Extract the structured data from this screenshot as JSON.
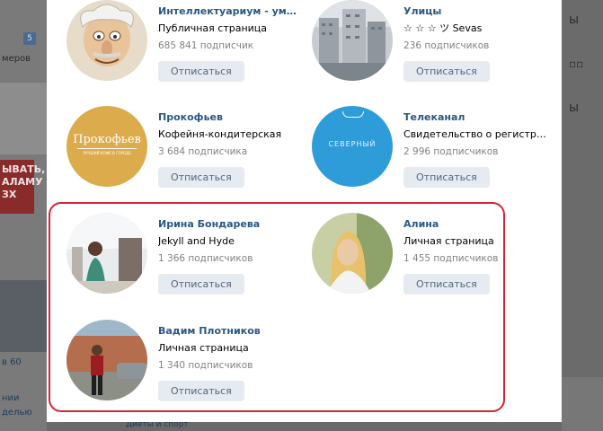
{
  "background": {
    "badge": "5",
    "text_lines": [
      "меров",
      "ЫВАТЬ,",
      "АЛАМУ",
      "ЗХ",
      "в 60",
      "нии",
      "делью",
      "Диеты и спорт"
    ],
    "right_text": [
      "ы",
      "ы"
    ]
  },
  "cards": [
    {
      "name": "Интеллектуариум - умный ...",
      "desc": "Публичная страница",
      "count": "685 841 подписчик",
      "button": "Отписаться",
      "avatar": "caricature-avatar"
    },
    {
      "name": "Улицы",
      "desc": "☆ ☆ ☆ ツ Sevas",
      "count": "236 подписчиков",
      "button": "Отписаться",
      "avatar": "buildings-avatar"
    },
    {
      "name": "Прокофьев",
      "desc": "Кофейня-кондитерская",
      "count": "3 684 подписчика",
      "button": "Отписаться",
      "avatar": "logo-avatar",
      "logo_text": "Прокофьев",
      "logo_sub": "ЛУЧШИЙ КОФЕ В ГОРОДЕ"
    },
    {
      "name": "Телеканал",
      "desc": "Свидетельство о регистра...",
      "count": "2 996 подписчиков",
      "button": "Отписаться",
      "avatar": "tv-avatar",
      "logo_text": "СЕВЕРНЫЙ"
    },
    {
      "name": "Ирина Бондарева",
      "desc": "Jekyll and Hyde",
      "count": "1 366 подписчиков",
      "button": "Отписаться",
      "avatar": "photo-avatar"
    },
    {
      "name": "Алина",
      "desc": "Личная страница",
      "count": "1 455 подписчиков",
      "button": "Отписаться",
      "avatar": "photo-avatar"
    },
    {
      "name": "Вадим Плотников",
      "desc": "Личная страница",
      "count": "1 340 подписчиков",
      "button": "Отписаться",
      "avatar": "photo-avatar"
    }
  ],
  "colors": {
    "link": "#2a5885",
    "button_bg": "#e5ebf1",
    "highlight": "#d5233a"
  }
}
